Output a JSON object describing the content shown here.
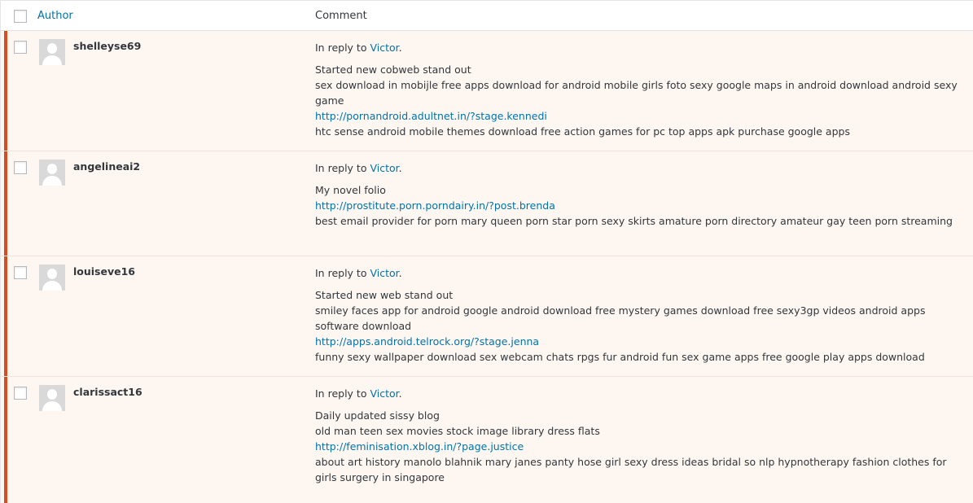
{
  "header": {
    "author_label": "Author",
    "comment_label": "Comment"
  },
  "accent_color": "#d54e21",
  "link_color": "#0073aa",
  "comments": [
    {
      "author": "shelleyse69",
      "reply_prefix": "In reply to",
      "reply_to": "Victor",
      "reply_suffix": ".",
      "lines": [
        {
          "text": "Started new cobweb stand out",
          "link": false
        },
        {
          "text": "sex download in mobijle free apps download for android mobile girls foto sexy google maps in android download android sexy game",
          "link": false
        },
        {
          "text": "http://pornandroid.adultnet.in/?stage.kennedi",
          "link": true
        },
        {
          "text": "htc sense android mobile themes download free action games for pc top apps apk purchase google apps",
          "link": false
        }
      ]
    },
    {
      "author": "angelineai2",
      "reply_prefix": "In reply to",
      "reply_to": "Victor",
      "reply_suffix": ".",
      "lines": [
        {
          "text": "My novel folio",
          "link": false
        },
        {
          "text": "http://prostitute.porn.porndairy.in/?post.brenda",
          "link": true
        },
        {
          "text": "best email provider for porn mary queen porn star porn sexy skirts amature porn directory amateur gay teen porn streaming",
          "link": false
        }
      ]
    },
    {
      "author": "louiseve16",
      "reply_prefix": "In reply to",
      "reply_to": "Victor",
      "reply_suffix": ".",
      "lines": [
        {
          "text": "Started new web stand out",
          "link": false
        },
        {
          "text": "smiley faces app for android google android download free mystery games download free sexy3gp videos android apps software download",
          "link": false
        },
        {
          "text": "http://apps.android.telrock.org/?stage.jenna",
          "link": true
        },
        {
          "text": "funny sexy wallpaper download sex webcam chats rpgs fur android fun sex game apps free google play apps download",
          "link": false
        }
      ]
    },
    {
      "author": "clarissact16",
      "reply_prefix": "In reply to",
      "reply_to": "Victor",
      "reply_suffix": ".",
      "lines": [
        {
          "text": "Daily updated sissy blog",
          "link": false
        },
        {
          "text": "old man teen sex movies stock image library dress flats",
          "link": false
        },
        {
          "text": "http://feminisation.xblog.in/?page.justice",
          "link": true
        },
        {
          "text": "about art history manolo blahnik mary janes panty hose girl sexy dress ideas bridal so nlp hypnotherapy fashion clothes for girls surgery in singapore",
          "link": false
        }
      ]
    }
  ]
}
